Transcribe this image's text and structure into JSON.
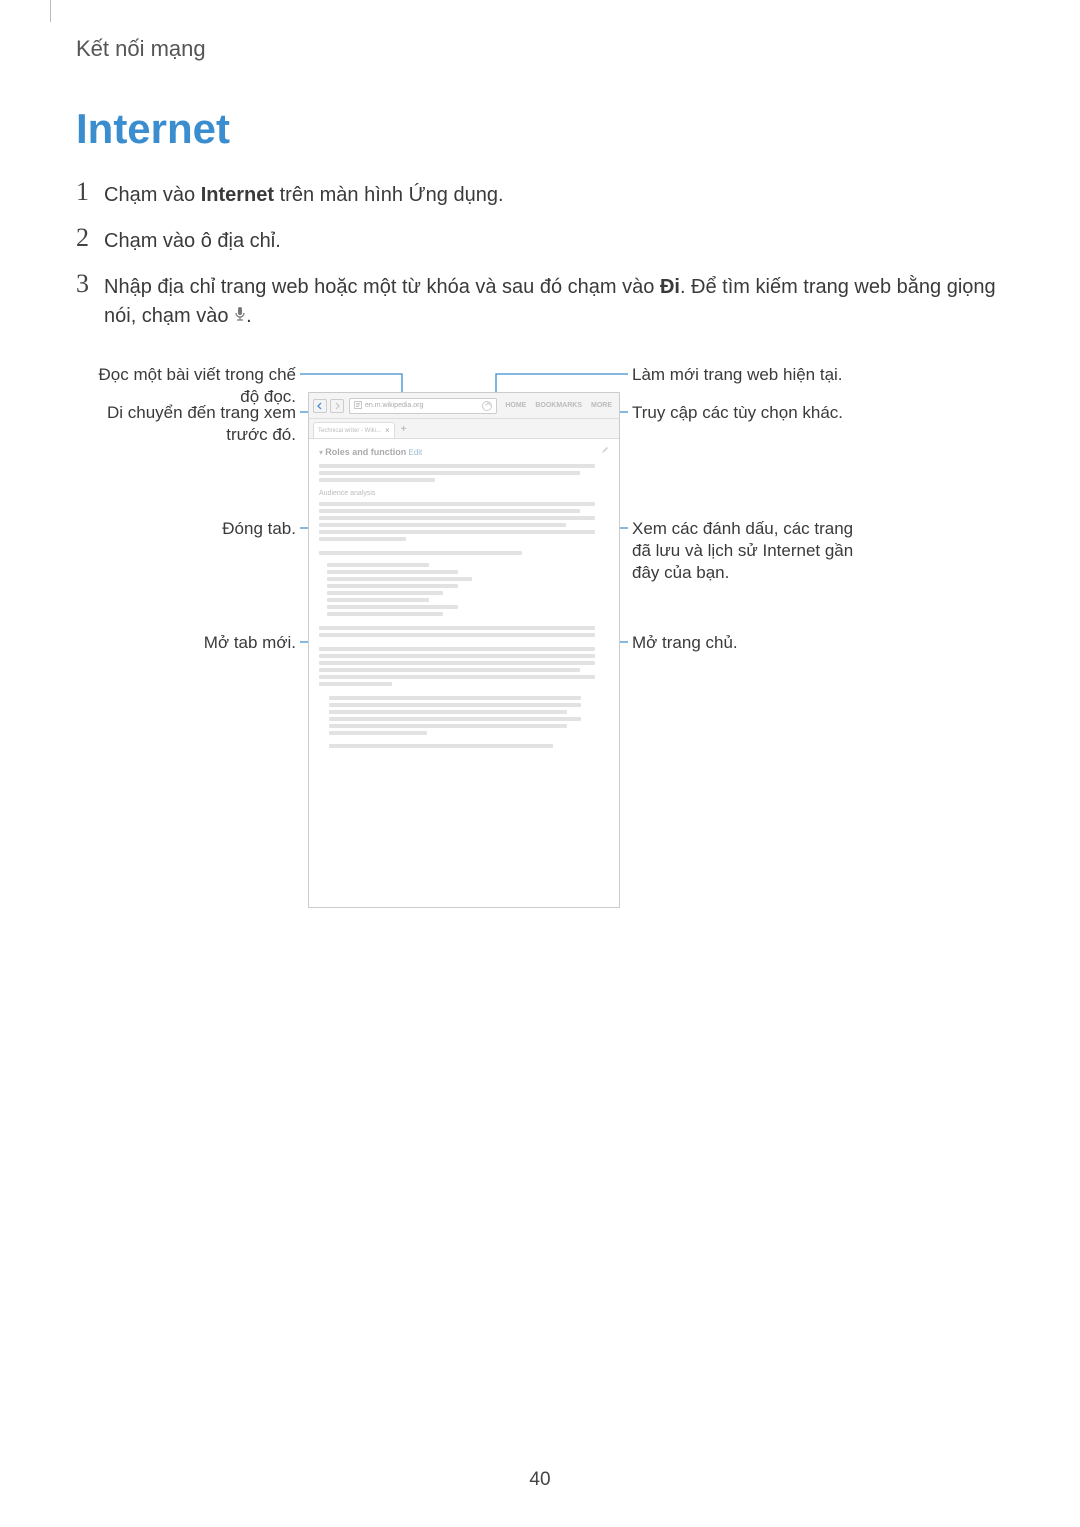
{
  "breadcrumb": "Kết nối mạng",
  "title": "Internet",
  "steps": {
    "one": {
      "num": "1",
      "pre": "Chạm vào ",
      "bold": "Internet",
      "post": " trên màn hình Ứng dụng."
    },
    "two": {
      "num": "2",
      "text": "Chạm vào ô địa chỉ."
    },
    "three": {
      "num": "3",
      "pre": "Nhập địa chỉ trang web hoặc một từ khóa và sau đó chạm vào ",
      "bold": "Đi",
      "post1": ". Để tìm kiếm trang web bằng giọng nói, chạm vào ",
      "post2": "."
    }
  },
  "labels": {
    "left": [
      "Đọc một bài viết trong chế độ đọc.",
      "Di chuyển đến trang xem trước đó.",
      "Đóng tab.",
      "Mở tab mới."
    ],
    "right": [
      "Làm mới trang web hiện tại.",
      "Truy cập các tùy chọn khác.",
      "Xem các đánh dấu, các trang đã lưu và lịch sử Internet gần đây của bạn.",
      "Mở trang chủ."
    ]
  },
  "browser": {
    "url_text": "en.m.wikipedia.org",
    "toolbar_links": [
      "HOME",
      "BOOKMARKS",
      "MORE"
    ],
    "tab_title": "Technical writer - Wiki...",
    "tab_close": "×",
    "tab_plus": "+",
    "content_title_prefix": "Roles and function",
    "subhead": "Audience analysis"
  },
  "page_number": "40"
}
